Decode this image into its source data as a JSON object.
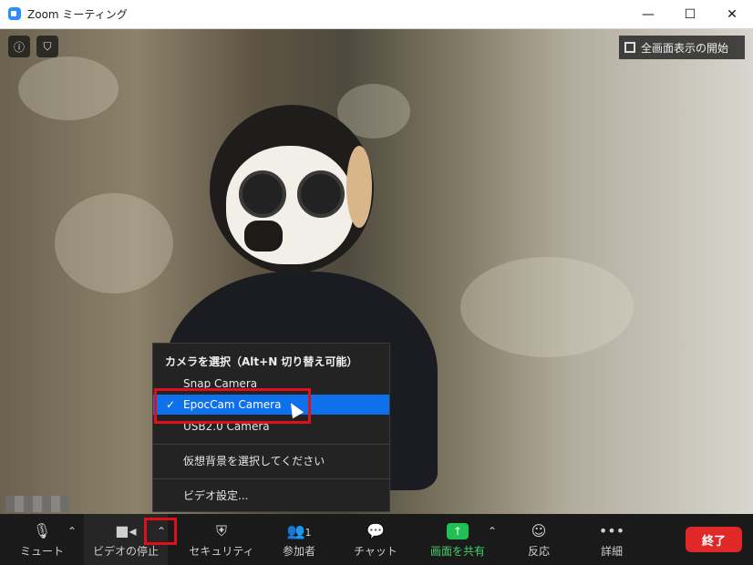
{
  "window": {
    "title": "Zoom ミーティング"
  },
  "overlay": {
    "fullscreen_label": "全画面表示の開始"
  },
  "camera_menu": {
    "header": "カメラを選択（Alt+N 切り替え可能）",
    "items": [
      {
        "label": "Snap Camera",
        "selected": false
      },
      {
        "label": "EpocCam Camera",
        "selected": true
      },
      {
        "label": "USB2.0 Camera",
        "selected": false
      }
    ],
    "virtual_bg": "仮想背景を選択してください",
    "video_settings": "ビデオ設定..."
  },
  "toolbar": {
    "mute": "ミュート",
    "stop_video": "ビデオの停止",
    "security": "セキュリティ",
    "participants": "参加者",
    "participants_count": "1",
    "chat": "チャット",
    "share": "画面を共有",
    "reactions": "反応",
    "more": "詳細",
    "end": "終了"
  },
  "colors": {
    "accent": "#0e71eb",
    "share": "#20c152",
    "end": "#e02828",
    "highlight_box": "#e0101a"
  },
  "icons": [
    "app-zoom-icon",
    "info-icon",
    "shield-icon",
    "fullscreen-icon",
    "mic-icon",
    "video-camera-icon",
    "security-shield-icon",
    "participants-icon",
    "chat-icon",
    "share-screen-icon",
    "reaction-icon",
    "more-icon",
    "check-icon",
    "mouse-cursor-icon"
  ]
}
